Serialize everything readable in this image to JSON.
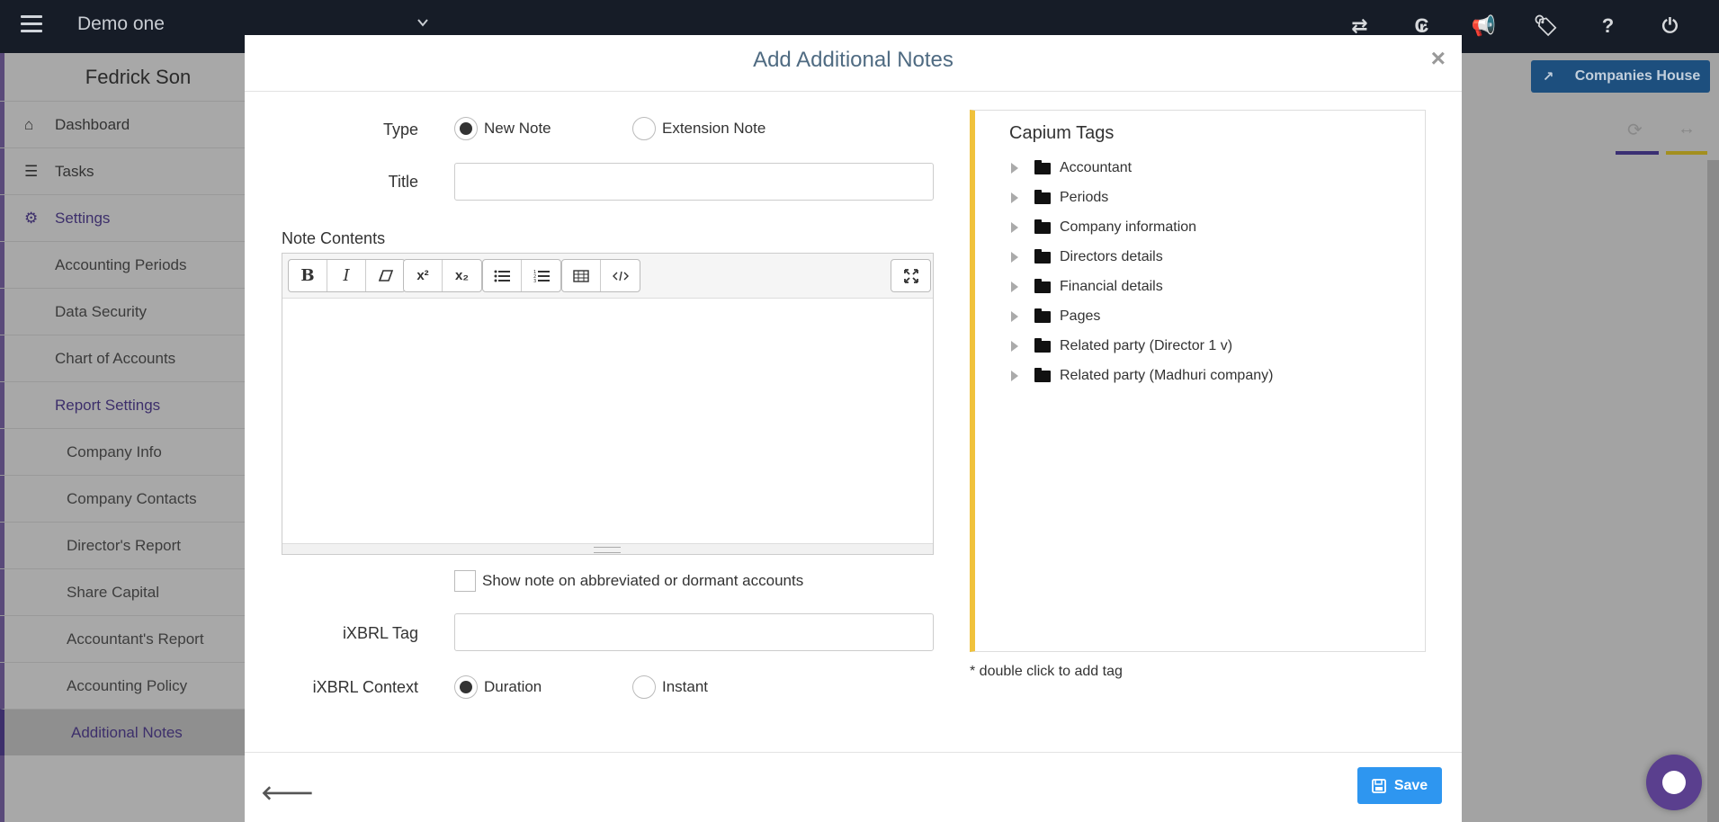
{
  "topbar": {
    "company": "Demo one",
    "icons": [
      "switch-icon",
      "currency-icon",
      "megaphone-icon",
      "tag-icon",
      "help-icon",
      "power-icon"
    ]
  },
  "sidebar": {
    "user_name": "Fedrick Son",
    "items": [
      {
        "label": "Dashboard",
        "icon": "home-icon"
      },
      {
        "label": "Tasks",
        "icon": "tasks-icon"
      },
      {
        "label": "Settings",
        "icon": "gear-icon"
      },
      {
        "label": "Accounting Periods"
      },
      {
        "label": "Data Security"
      },
      {
        "label": "Chart of Accounts"
      },
      {
        "label": "Report Settings"
      },
      {
        "label": "Company Info"
      },
      {
        "label": "Company Contacts"
      },
      {
        "label": "Director's Report"
      },
      {
        "label": "Share Capital"
      },
      {
        "label": "Accountant's Report"
      },
      {
        "label": "Accounting Policy"
      },
      {
        "label": "Additional Notes"
      }
    ]
  },
  "background": {
    "companies_house_label": "Companies House"
  },
  "modal": {
    "title": "Add Additional Notes",
    "close": "×",
    "type_label": "Type",
    "type_options": [
      "New Note",
      "Extension Note"
    ],
    "type_selected": "New Note",
    "title_label": "Title",
    "title_value": "",
    "note_contents_label": "Note Contents",
    "editor_buttons": [
      "B",
      "I",
      "eraser",
      "x²",
      "x₂",
      "bullets",
      "numbers",
      "table",
      "code",
      "fullscreen"
    ],
    "checkbox_label": "Show note on abbreviated or dormant accounts",
    "checkbox_checked": false,
    "ixbrl_tag_label": "iXBRL Tag",
    "ixbrl_tag_value": "",
    "ixbrl_context_label": "iXBRL Context",
    "context_options": [
      "Duration",
      "Instant"
    ],
    "context_selected": "Duration",
    "tags_title": "Capium Tags",
    "tags": [
      "Accountant",
      "Periods",
      "Company information",
      "Directors details",
      "Financial details",
      "Pages",
      "Related party (Director 1 v)",
      "Related party (Madhuri company)"
    ],
    "tags_hint": "* double click to add tag",
    "save_label": "Save"
  },
  "colors": {
    "topbar": "#161c27",
    "accent_save": "#2e96f0",
    "tags_border": "#f0c23c",
    "title_color": "#4f6b82"
  }
}
